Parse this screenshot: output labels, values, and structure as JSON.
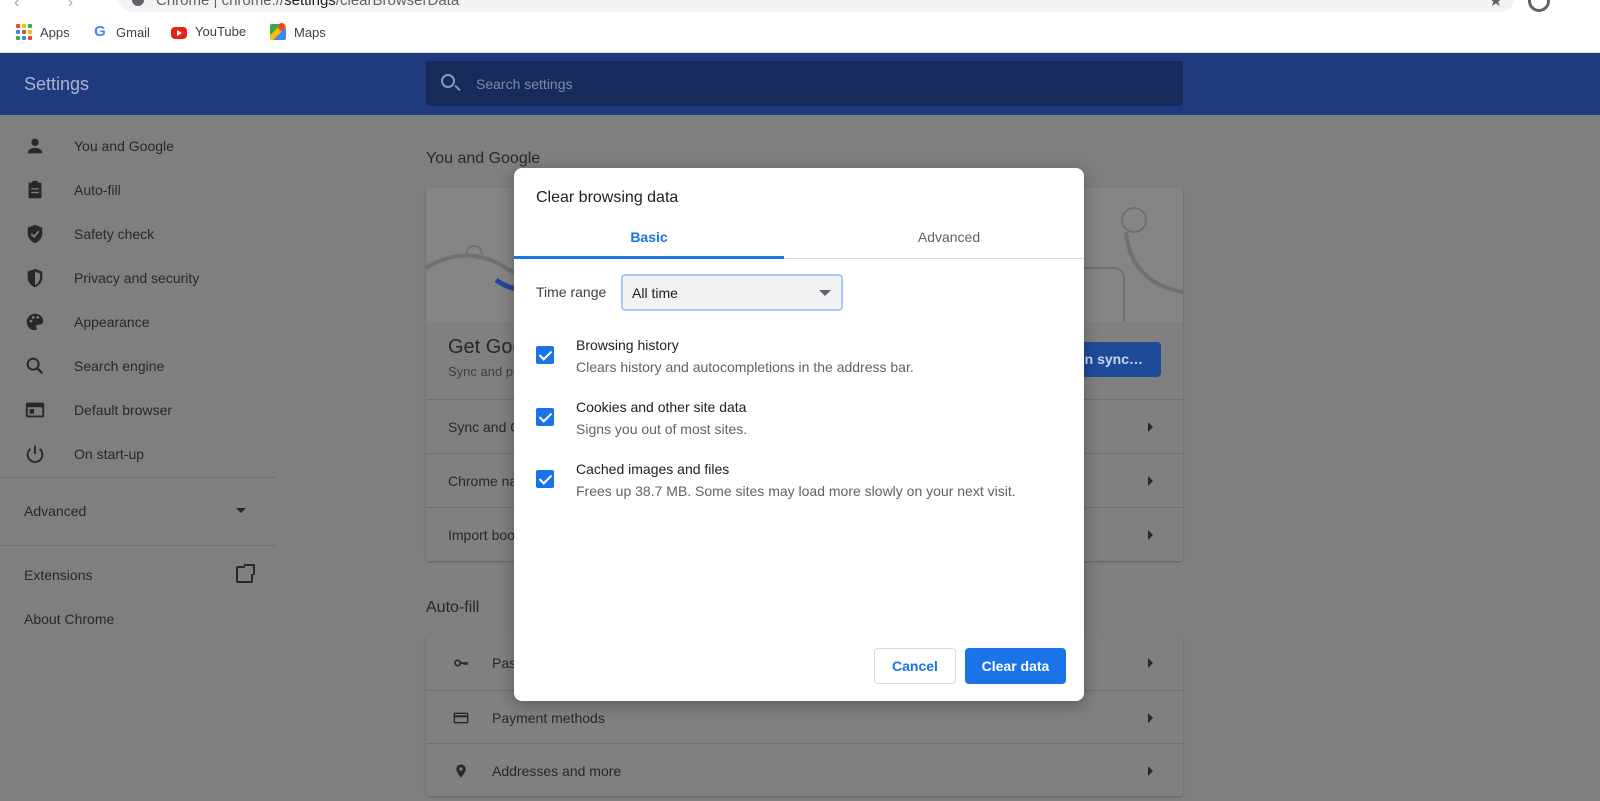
{
  "browser": {
    "omnibox_prefix": "Chrome  |  chrome://",
    "omnibox_host": "settings",
    "omnibox_path": "/clearBrowserData",
    "bookmarks": [
      {
        "label": "Apps",
        "icon": "apps-grid-icon"
      },
      {
        "label": "Gmail",
        "icon": "google-icon"
      },
      {
        "label": "YouTube",
        "icon": "youtube-icon"
      },
      {
        "label": "Maps",
        "icon": "maps-icon"
      }
    ]
  },
  "header": {
    "title": "Settings",
    "search_placeholder": "Search settings"
  },
  "sidebar": {
    "items": [
      {
        "label": "You and Google",
        "icon": "person-icon"
      },
      {
        "label": "Auto-fill",
        "icon": "clipboard-icon"
      },
      {
        "label": "Safety check",
        "icon": "shield-check-icon"
      },
      {
        "label": "Privacy and security",
        "icon": "shield-icon"
      },
      {
        "label": "Appearance",
        "icon": "palette-icon"
      },
      {
        "label": "Search engine",
        "icon": "search-icon"
      },
      {
        "label": "Default browser",
        "icon": "browser-icon"
      },
      {
        "label": "On start-up",
        "icon": "power-icon"
      }
    ],
    "advanced": "Advanced",
    "extensions": "Extensions",
    "about": "About Chrome"
  },
  "main": {
    "section1_title": "You and Google",
    "get_google": "Get Goo",
    "sync_sub": "Sync and p",
    "sync_button": "on sync…",
    "rows1": [
      "Sync and G",
      "Chrome na",
      "Import boo"
    ],
    "section2_title": "Auto-fill",
    "rows2": [
      {
        "label": "Pas",
        "icon": "key-icon"
      },
      {
        "label": "Payment methods",
        "icon": "credit-card-icon"
      },
      {
        "label": "Addresses and more",
        "icon": "location-pin-icon"
      }
    ]
  },
  "dialog": {
    "title": "Clear browsing data",
    "tabs": [
      "Basic",
      "Advanced"
    ],
    "time_range_label": "Time range",
    "time_range_value": "All time",
    "options": [
      {
        "title": "Browsing history",
        "desc": "Clears history and autocompletions in the address bar.",
        "checked": true
      },
      {
        "title": "Cookies and other site data",
        "desc": "Signs you out of most sites.",
        "checked": true
      },
      {
        "title": "Cached images and files",
        "desc": "Frees up 38.7 MB. Some sites may load more slowly on your next visit.",
        "checked": true
      }
    ],
    "cancel": "Cancel",
    "clear": "Clear data"
  },
  "colors": {
    "accent": "#1a73e8",
    "header_bg": "#1f3a7d"
  }
}
